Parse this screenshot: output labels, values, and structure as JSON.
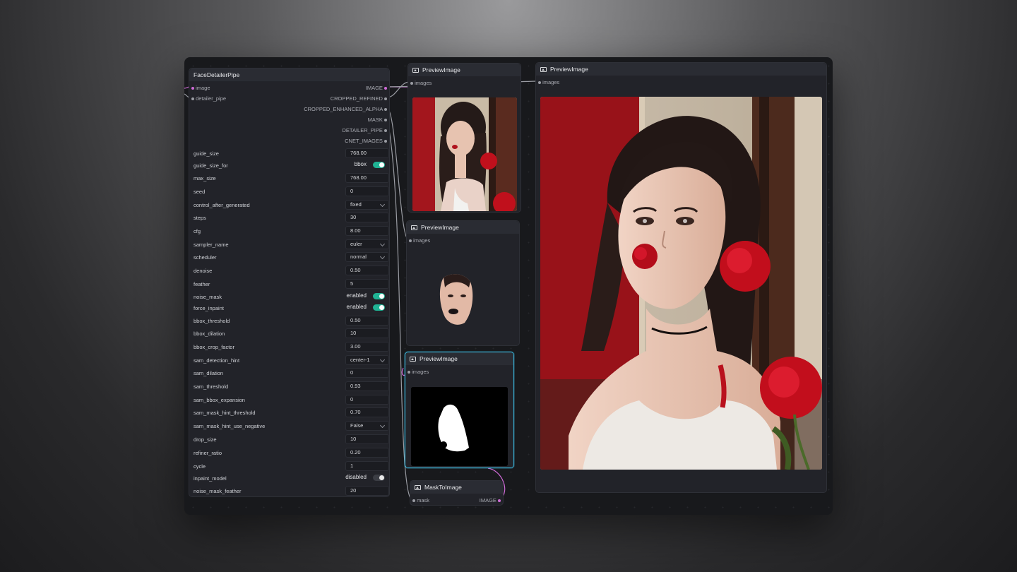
{
  "face_detailer": {
    "title": "FaceDetailerPipe",
    "inputs": [
      "image",
      "detailer_pipe"
    ],
    "outputs": [
      "IMAGE",
      "CROPPED_REFINED",
      "CROPPED_ENHANCED_ALPHA",
      "MASK",
      "DETAILER_PIPE",
      "CNET_IMAGES"
    ],
    "widgets": [
      {
        "label": "guide_size",
        "value": "768.00",
        "kind": "number"
      },
      {
        "label": "guide_size_for",
        "value": "bbox",
        "kind": "toggle",
        "on": true
      },
      {
        "label": "max_size",
        "value": "768.00",
        "kind": "number"
      },
      {
        "label": "seed",
        "value": "0",
        "kind": "number"
      },
      {
        "label": "control_after_generated",
        "value": "fixed",
        "kind": "select"
      },
      {
        "label": "steps",
        "value": "30",
        "kind": "number"
      },
      {
        "label": "cfg",
        "value": "8.00",
        "kind": "number"
      },
      {
        "label": "sampler_name",
        "value": "euler",
        "kind": "select"
      },
      {
        "label": "scheduler",
        "value": "normal",
        "kind": "select"
      },
      {
        "label": "denoise",
        "value": "0.50",
        "kind": "number"
      },
      {
        "label": "feather",
        "value": "5",
        "kind": "number"
      },
      {
        "label": "noise_mask",
        "value": "enabled",
        "kind": "toggle",
        "on": true
      },
      {
        "label": "force_inpaint",
        "value": "enabled",
        "kind": "toggle",
        "on": true
      },
      {
        "label": "bbox_threshold",
        "value": "0.50",
        "kind": "number"
      },
      {
        "label": "bbox_dilation",
        "value": "10",
        "kind": "number"
      },
      {
        "label": "bbox_crop_factor",
        "value": "3.00",
        "kind": "number"
      },
      {
        "label": "sam_detection_hint",
        "value": "center-1",
        "kind": "select"
      },
      {
        "label": "sam_dilation",
        "value": "0",
        "kind": "number"
      },
      {
        "label": "sam_threshold",
        "value": "0.93",
        "kind": "number"
      },
      {
        "label": "sam_bbox_expansion",
        "value": "0",
        "kind": "number"
      },
      {
        "label": "sam_mask_hint_threshold",
        "value": "0.70",
        "kind": "number"
      },
      {
        "label": "sam_mask_hint_use_negative",
        "value": "False",
        "kind": "select"
      },
      {
        "label": "drop_size",
        "value": "10",
        "kind": "number"
      },
      {
        "label": "refiner_ratio",
        "value": "0.20",
        "kind": "number"
      },
      {
        "label": "cycle",
        "value": "1",
        "kind": "number"
      },
      {
        "label": "inpaint_model",
        "value": "disabled",
        "kind": "toggle",
        "on": false
      },
      {
        "label": "noise_mask_feather",
        "value": "20",
        "kind": "number"
      }
    ]
  },
  "preview1": {
    "title": "PreviewImage",
    "input": "images"
  },
  "preview2": {
    "title": "PreviewImage",
    "input": "images"
  },
  "preview3": {
    "title": "PreviewImage",
    "input": "images"
  },
  "preview_large": {
    "title": "PreviewImage",
    "input": "images"
  },
  "mask_to_image": {
    "title": "MaskToImage",
    "input": "mask",
    "output": "IMAGE"
  },
  "colors": {
    "accent_toggle": "#1fb394",
    "selected_border": "#3ab4d8",
    "image_link": "#d06bd8"
  }
}
